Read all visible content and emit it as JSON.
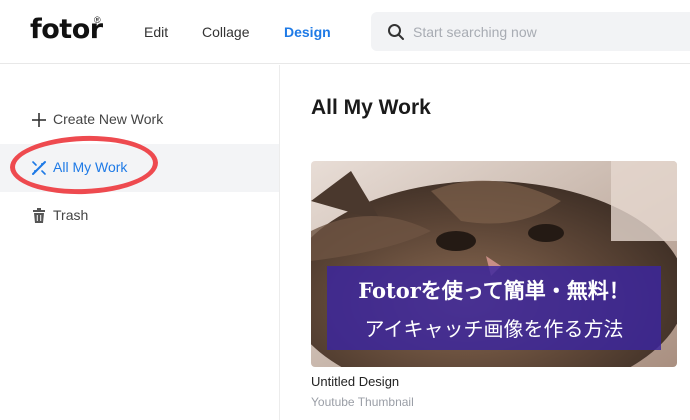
{
  "header": {
    "logo_text": "fotor",
    "logo_mark": "®",
    "nav": [
      {
        "label": "Edit",
        "active": false
      },
      {
        "label": "Collage",
        "active": false
      },
      {
        "label": "Design",
        "active": true
      }
    ],
    "search": {
      "placeholder": "Start searching now",
      "value": "",
      "icon": "search-icon"
    },
    "accent_color": "#1e7ae6"
  },
  "sidebar": {
    "items": [
      {
        "label": "Create New Work",
        "icon": "plus-icon",
        "selected": false
      },
      {
        "label": "All My Work",
        "icon": "magic-wand-icon",
        "selected": true
      },
      {
        "label": "Trash",
        "icon": "trash-icon",
        "selected": false
      }
    ],
    "highlight_color": "#ee4a4f"
  },
  "main": {
    "title": "All My Work",
    "cards": [
      {
        "thumbnail_text_line1": "Fotorを使って簡単・無料！",
        "thumbnail_text_line2": "アイキャッチ画像を作る方法",
        "title": "Untitled Design",
        "type": "Youtube Thumbnail"
      }
    ]
  }
}
